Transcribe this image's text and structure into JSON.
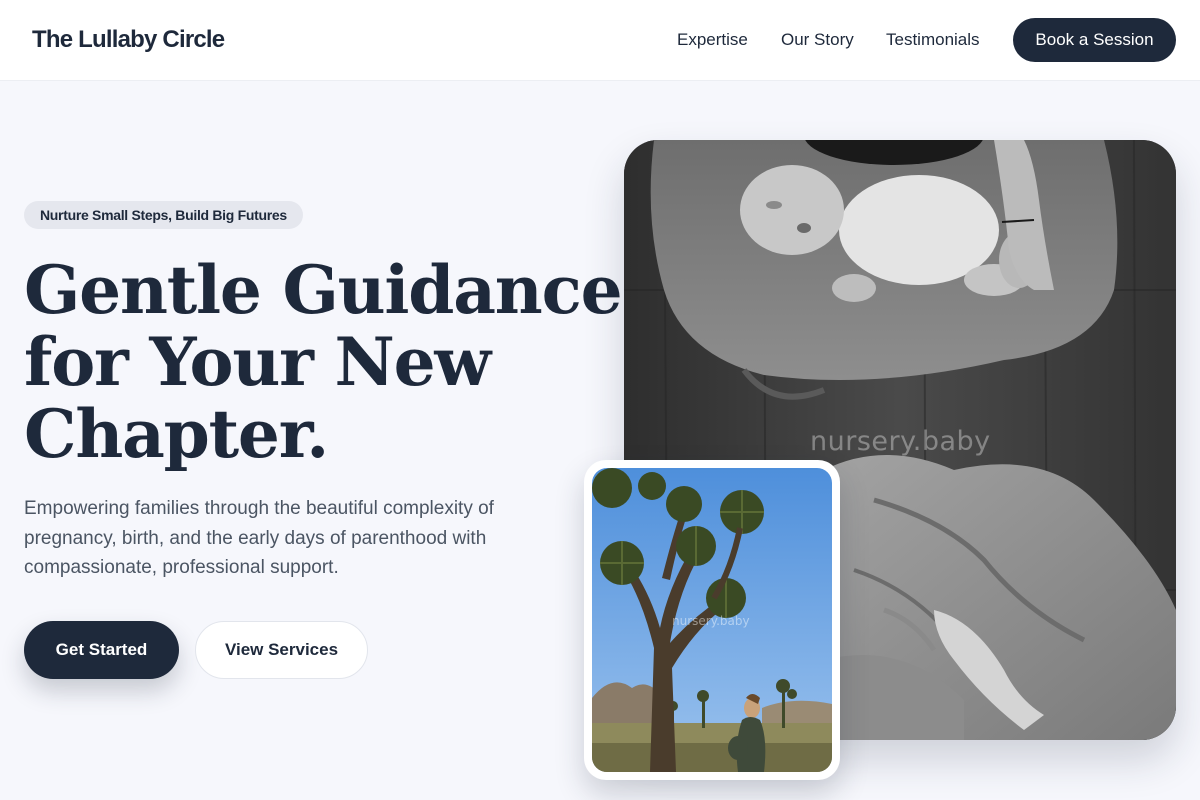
{
  "header": {
    "logo": "The Lullaby Circle",
    "nav": [
      {
        "label": "Expertise"
      },
      {
        "label": "Our Story"
      },
      {
        "label": "Testimonials"
      }
    ],
    "cta_label": "Book a Session"
  },
  "hero": {
    "tagline": "Nurture Small Steps, Build Big Futures",
    "headline_lines": [
      "Gentle Guidance",
      "for Your New",
      "Chapter."
    ],
    "subtext": "Empowering families through the beautiful complexity of pregnancy, birth, and the early days of parenthood with compassionate, professional support.",
    "primary_button": "Get Started",
    "secondary_button": "View Services"
  },
  "images": {
    "main_watermark": "nursery.baby",
    "inset_watermark": "nursery.baby"
  },
  "colors": {
    "primary": "#1e293b",
    "background": "#f6f7fc",
    "tagline_bg": "#e5e7ee",
    "body_text": "#4b5563"
  }
}
